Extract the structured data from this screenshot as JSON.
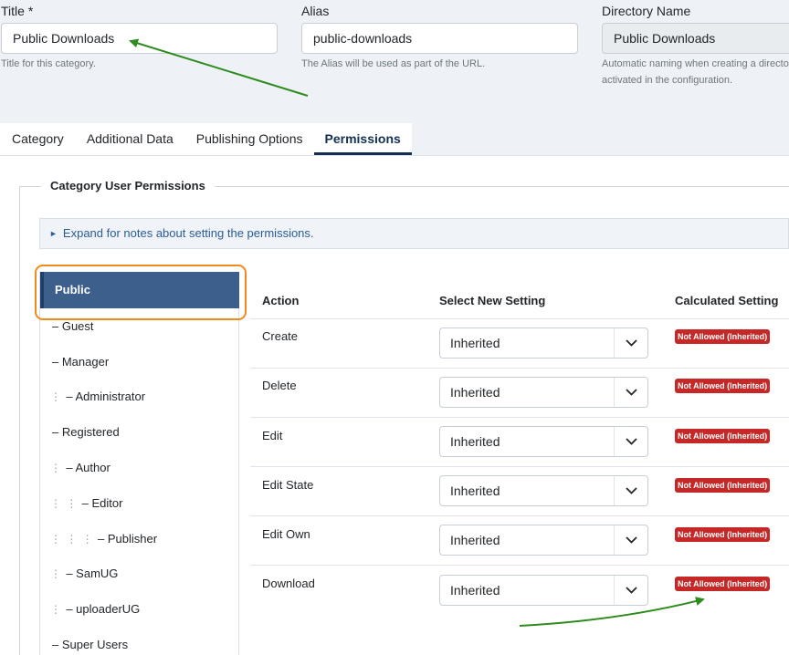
{
  "form": {
    "title": {
      "label": "Title *",
      "value": "Public Downloads",
      "help": "Title for this category."
    },
    "alias": {
      "label": "Alias",
      "value": "public-downloads",
      "help": "The Alias will be used as part of the URL."
    },
    "directory": {
      "label": "Directory Name",
      "value": "Public Downloads",
      "help_line1": "Automatic naming when creating a directo",
      "help_line2": "activated in the configuration."
    }
  },
  "tabs": [
    "Category",
    "Additional Data",
    "Publishing Options",
    "Permissions"
  ],
  "permissions": {
    "legend": "Category User Permissions",
    "notes_toggle": "Expand for notes about setting the permissions.",
    "groups": [
      "Public",
      "– Guest",
      "– Manager",
      "– Administrator",
      "– Registered",
      "– Author",
      "– Editor",
      "– Publisher",
      "– SamUG",
      "– uploaderUG",
      "– Super Users"
    ],
    "headers": {
      "action": "Action",
      "select": "Select New Setting",
      "calculated": "Calculated Setting"
    },
    "rows": [
      {
        "action": "Create",
        "setting": "Inherited",
        "calculated": "Not Allowed (Inherited)"
      },
      {
        "action": "Delete",
        "setting": "Inherited",
        "calculated": "Not Allowed (Inherited)"
      },
      {
        "action": "Edit",
        "setting": "Inherited",
        "calculated": "Not Allowed (Inherited)"
      },
      {
        "action": "Edit State",
        "setting": "Inherited",
        "calculated": "Not Allowed (Inherited)"
      },
      {
        "action": "Edit Own",
        "setting": "Inherited",
        "calculated": "Not Allowed (Inherited)"
      },
      {
        "action": "Download",
        "setting": "Inherited",
        "calculated": "Not Allowed (Inherited)"
      }
    ]
  },
  "colors": {
    "accent": "#3d5f8c",
    "badge": "#c52827",
    "highlight": "#f08a1c",
    "annotation": "#2e8b1e"
  }
}
